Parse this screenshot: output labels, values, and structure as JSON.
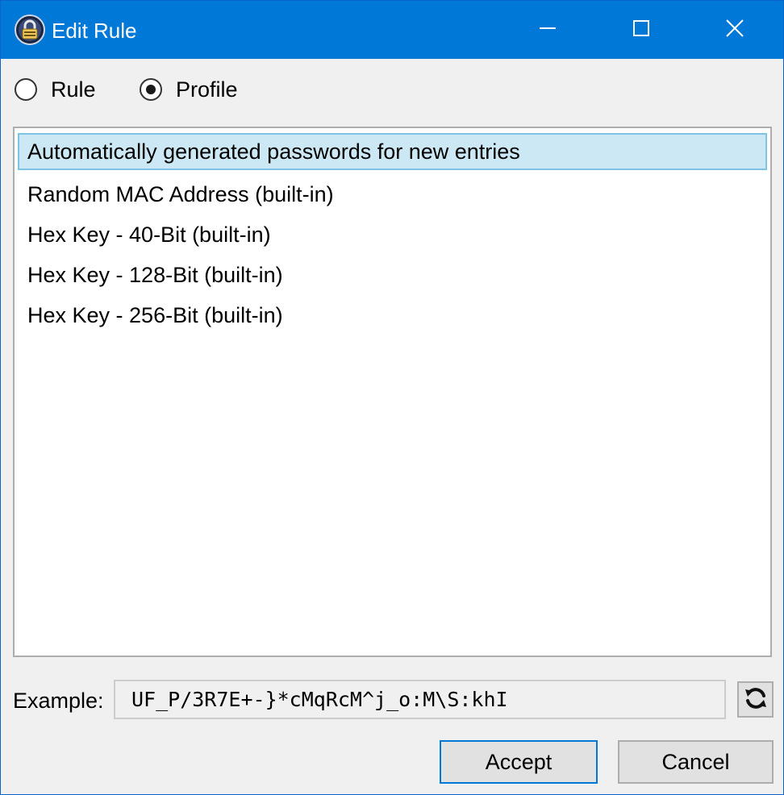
{
  "window": {
    "title": "Edit Rule",
    "title_bar_color": "#0078d7",
    "controls": [
      "minimize-icon",
      "maximize-icon",
      "close-icon"
    ]
  },
  "mode": {
    "options": [
      {
        "label": "Rule",
        "selected": false
      },
      {
        "label": "Profile",
        "selected": true
      }
    ]
  },
  "profiles": {
    "items": [
      {
        "label": "Automatically generated passwords for new entries",
        "selected": true
      },
      {
        "label": "Random MAC Address (built-in)",
        "selected": false
      },
      {
        "label": "Hex Key - 40-Bit (built-in)",
        "selected": false
      },
      {
        "label": "Hex Key - 128-Bit (built-in)",
        "selected": false
      },
      {
        "label": "Hex Key - 256-Bit (built-in)",
        "selected": false
      }
    ],
    "selection_color": "#cce8f4"
  },
  "example": {
    "label": "Example:",
    "value": "UF_P/3R7E+-}*cMqRcM^j_o:M\\S:khI",
    "refresh_icon": "refresh-icon"
  },
  "buttons": {
    "accept": "Accept",
    "cancel": "Cancel"
  }
}
